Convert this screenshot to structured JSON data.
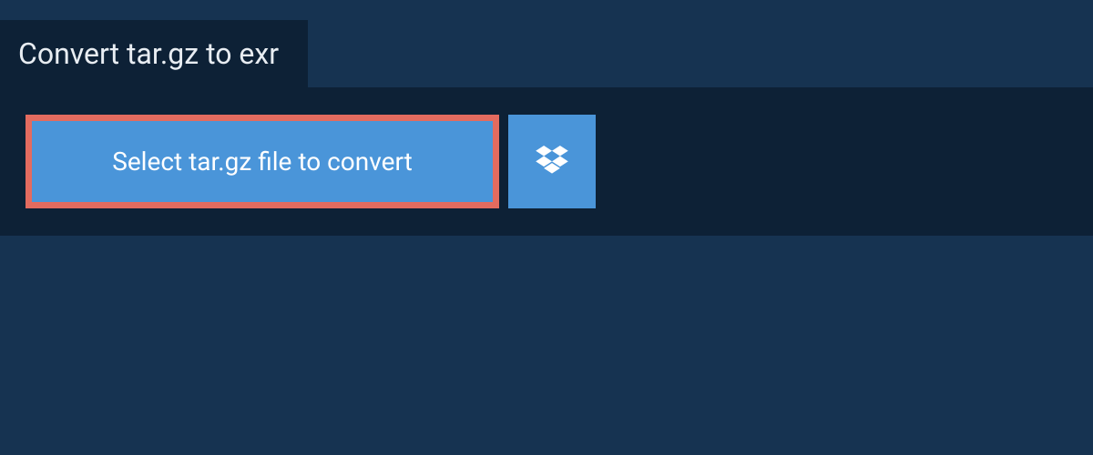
{
  "tab": {
    "title": "Convert tar.gz to exr"
  },
  "actions": {
    "select_label": "Select tar.gz file to convert"
  },
  "colors": {
    "bg_outer": "#163351",
    "bg_panel": "#0d2136",
    "button_bg": "#4a95d9",
    "highlight_border": "#e36b5f",
    "text_light": "#e8edf2",
    "text_white": "#ffffff"
  }
}
